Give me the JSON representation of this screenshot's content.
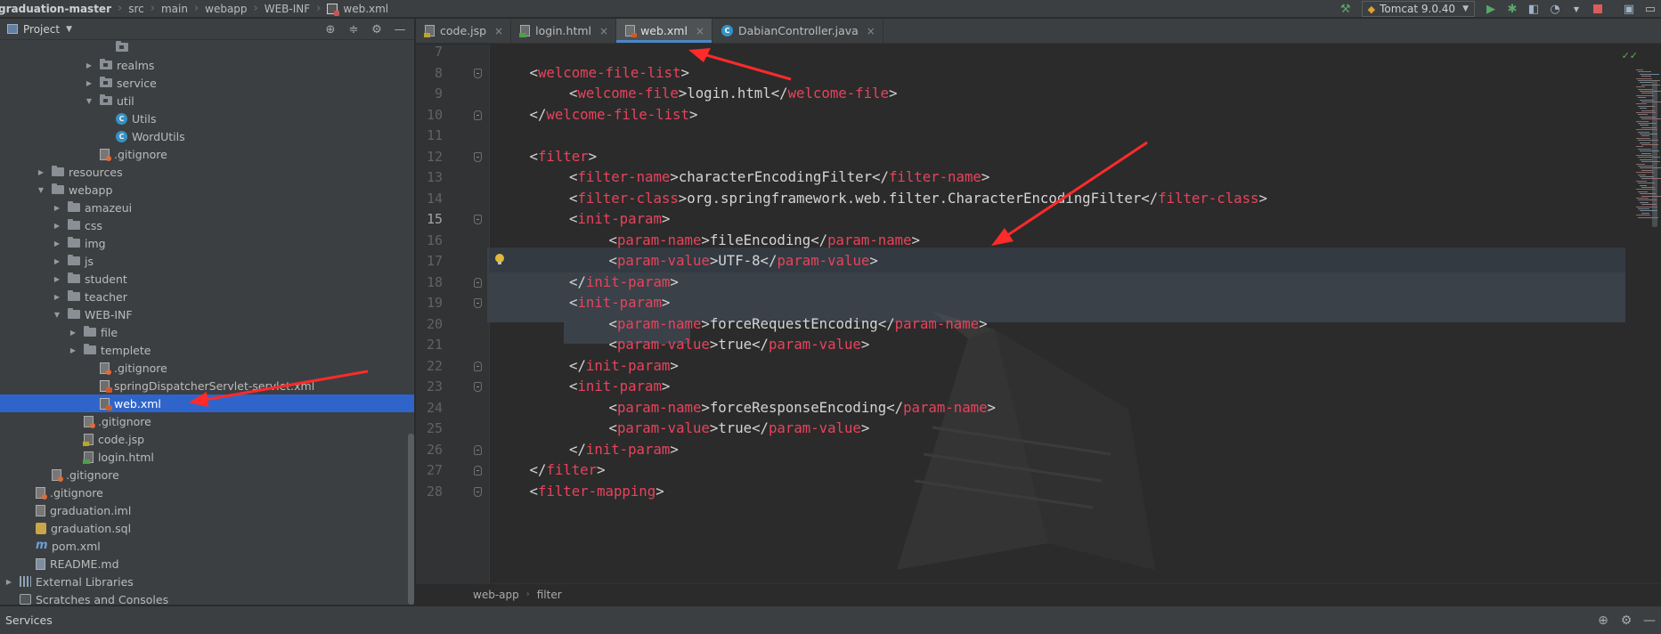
{
  "navbar": {
    "crumbs": [
      "graduation-master",
      "src",
      "main",
      "webapp",
      "WEB-INF",
      "web.xml"
    ],
    "run_config": "Tomcat 9.0.40",
    "icons": [
      "hammer-icon",
      "run-icon",
      "debug-icon",
      "coverage-icon",
      "profile-icon",
      "stop-icon",
      "project-structure-icon",
      "terminal-icon"
    ]
  },
  "project_panel": {
    "title": "Project",
    "tree": [
      {
        "label": "",
        "depth": 6,
        "type": "package",
        "cut": true
      },
      {
        "label": "realms",
        "depth": 5,
        "type": "package",
        "twisty": "collapsed"
      },
      {
        "label": "service",
        "depth": 5,
        "type": "package",
        "twisty": "collapsed"
      },
      {
        "label": "util",
        "depth": 5,
        "type": "package",
        "twisty": "expanded"
      },
      {
        "label": "Utils",
        "depth": 6,
        "type": "class"
      },
      {
        "label": "WordUtils",
        "depth": 6,
        "type": "class"
      },
      {
        "label": ".gitignore",
        "depth": 5,
        "type": "git"
      },
      {
        "label": "resources",
        "depth": 2,
        "type": "folder",
        "twisty": "collapsed"
      },
      {
        "label": "webapp",
        "depth": 2,
        "type": "folder",
        "twisty": "expanded"
      },
      {
        "label": "amazeui",
        "depth": 3,
        "type": "folder",
        "twisty": "collapsed"
      },
      {
        "label": "css",
        "depth": 3,
        "type": "folder",
        "twisty": "collapsed"
      },
      {
        "label": "img",
        "depth": 3,
        "type": "folder",
        "twisty": "collapsed"
      },
      {
        "label": "js",
        "depth": 3,
        "type": "folder",
        "twisty": "collapsed"
      },
      {
        "label": "student",
        "depth": 3,
        "type": "folder",
        "twisty": "collapsed"
      },
      {
        "label": "teacher",
        "depth": 3,
        "type": "folder",
        "twisty": "collapsed"
      },
      {
        "label": "WEB-INF",
        "depth": 3,
        "type": "folder",
        "twisty": "expanded"
      },
      {
        "label": "file",
        "depth": 4,
        "type": "folder",
        "twisty": "collapsed"
      },
      {
        "label": "templete",
        "depth": 4,
        "type": "folder",
        "twisty": "collapsed"
      },
      {
        "label": ".gitignore",
        "depth": 5,
        "type": "git"
      },
      {
        "label": "springDispatcherServlet-servlet.xml",
        "depth": 5,
        "type": "xml"
      },
      {
        "label": "web.xml",
        "depth": 5,
        "type": "xml",
        "selected": true
      },
      {
        "label": ".gitignore",
        "depth": 4,
        "type": "git"
      },
      {
        "label": "code.jsp",
        "depth": 4,
        "type": "jsp"
      },
      {
        "label": "login.html",
        "depth": 4,
        "type": "html"
      },
      {
        "label": ".gitignore",
        "depth": 2,
        "type": "git"
      },
      {
        "label": ".gitignore",
        "depth": 1,
        "type": "git"
      },
      {
        "label": "graduation.iml",
        "depth": 1,
        "type": "iml"
      },
      {
        "label": "graduation.sql",
        "depth": 1,
        "type": "sql"
      },
      {
        "label": "pom.xml",
        "depth": 1,
        "type": "maven"
      },
      {
        "label": "README.md",
        "depth": 1,
        "type": "md"
      },
      {
        "label": "External Libraries",
        "depth": 0,
        "type": "lib",
        "twisty": "collapsed"
      },
      {
        "label": "Scratches and Consoles",
        "depth": 0,
        "type": "scratch"
      }
    ]
  },
  "tabs": [
    {
      "label": "code.jsp",
      "type": "jsp"
    },
    {
      "label": "login.html",
      "type": "html"
    },
    {
      "label": "web.xml",
      "type": "xml",
      "active": true
    },
    {
      "label": "DabianController.java",
      "type": "java"
    }
  ],
  "editor": {
    "current_line": 15,
    "lines": [
      {
        "n": 7,
        "code": []
      },
      {
        "n": 8,
        "indent": 1,
        "fold": "start",
        "code": [
          [
            "bk",
            "<"
          ],
          [
            "tg",
            "welcome-file-list"
          ],
          [
            "bk",
            ">"
          ]
        ]
      },
      {
        "n": 9,
        "indent": 2,
        "code": [
          [
            "bk",
            "<"
          ],
          [
            "tg",
            "welcome-file"
          ],
          [
            "bk",
            ">"
          ],
          [
            "tx",
            "login.html"
          ],
          [
            "bk",
            "</"
          ],
          [
            "tg",
            "welcome-file"
          ],
          [
            "bk",
            ">"
          ]
        ]
      },
      {
        "n": 10,
        "indent": 1,
        "fold": "end",
        "code": [
          [
            "bk",
            "</"
          ],
          [
            "tg",
            "welcome-file-list"
          ],
          [
            "bk",
            ">"
          ]
        ]
      },
      {
        "n": 11,
        "code": []
      },
      {
        "n": 12,
        "indent": 1,
        "fold": "start",
        "code": [
          [
            "bk",
            "<"
          ],
          [
            "tg",
            "filter"
          ],
          [
            "bk",
            ">"
          ]
        ]
      },
      {
        "n": 13,
        "indent": 2,
        "code": [
          [
            "bk",
            "<"
          ],
          [
            "tg",
            "filter-name"
          ],
          [
            "bk",
            ">"
          ],
          [
            "tx",
            "characterEncodingFilter"
          ],
          [
            "bk",
            "</"
          ],
          [
            "tg",
            "filter-name"
          ],
          [
            "bk",
            ">"
          ]
        ]
      },
      {
        "n": 14,
        "indent": 2,
        "code": [
          [
            "bk",
            "<"
          ],
          [
            "tg",
            "filter-class"
          ],
          [
            "bk",
            ">"
          ],
          [
            "tx",
            "org.springframework.web.filter.CharacterEncodingFilter"
          ],
          [
            "bk",
            "</"
          ],
          [
            "tg",
            "filter-class"
          ],
          [
            "bk",
            ">"
          ]
        ]
      },
      {
        "n": 15,
        "indent": 2,
        "fold": "start",
        "code": [
          [
            "bk",
            "<"
          ],
          [
            "tg",
            "init-param"
          ],
          [
            "bk",
            ">"
          ]
        ]
      },
      {
        "n": 16,
        "indent": 3,
        "code": [
          [
            "bk",
            "<"
          ],
          [
            "tg",
            "param-name"
          ],
          [
            "bk",
            ">"
          ],
          [
            "tx",
            "fileEncoding"
          ],
          [
            "bk",
            "</"
          ],
          [
            "tg",
            "param-name"
          ],
          [
            "bk",
            ">"
          ]
        ]
      },
      {
        "n": 17,
        "indent": 3,
        "code": [
          [
            "bk",
            "<"
          ],
          [
            "tg",
            "param-value"
          ],
          [
            "bk",
            ">"
          ],
          [
            "tx",
            "UTF-8"
          ],
          [
            "bk",
            "</"
          ],
          [
            "tg",
            "param-value"
          ],
          [
            "bk",
            ">"
          ]
        ]
      },
      {
        "n": 18,
        "indent": 2,
        "fold": "end",
        "code": [
          [
            "bk",
            "</"
          ],
          [
            "tg",
            "init-param"
          ],
          [
            "bk",
            ">"
          ]
        ]
      },
      {
        "n": 19,
        "indent": 2,
        "fold": "start",
        "code": [
          [
            "bk",
            "<"
          ],
          [
            "tg",
            "init-param"
          ],
          [
            "bk",
            ">"
          ]
        ]
      },
      {
        "n": 20,
        "indent": 3,
        "code": [
          [
            "bk",
            "<"
          ],
          [
            "tg",
            "param-name"
          ],
          [
            "bk",
            ">"
          ],
          [
            "tx",
            "forceRequestEncoding"
          ],
          [
            "bk",
            "</"
          ],
          [
            "tg",
            "param-name"
          ],
          [
            "bk",
            ">"
          ]
        ]
      },
      {
        "n": 21,
        "indent": 3,
        "code": [
          [
            "bk",
            "<"
          ],
          [
            "tg",
            "param-value"
          ],
          [
            "bk",
            ">"
          ],
          [
            "tx",
            "true"
          ],
          [
            "bk",
            "</"
          ],
          [
            "tg",
            "param-value"
          ],
          [
            "bk",
            ">"
          ]
        ]
      },
      {
        "n": 22,
        "indent": 2,
        "fold": "end",
        "code": [
          [
            "bk",
            "</"
          ],
          [
            "tg",
            "init-param"
          ],
          [
            "bk",
            ">"
          ]
        ]
      },
      {
        "n": 23,
        "indent": 2,
        "fold": "start",
        "code": [
          [
            "bk",
            "<"
          ],
          [
            "tg",
            "init-param"
          ],
          [
            "bk",
            ">"
          ]
        ]
      },
      {
        "n": 24,
        "indent": 3,
        "code": [
          [
            "bk",
            "<"
          ],
          [
            "tg",
            "param-name"
          ],
          [
            "bk",
            ">"
          ],
          [
            "tx",
            "forceResponseEncoding"
          ],
          [
            "bk",
            "</"
          ],
          [
            "tg",
            "param-name"
          ],
          [
            "bk",
            ">"
          ]
        ]
      },
      {
        "n": 25,
        "indent": 3,
        "code": [
          [
            "bk",
            "<"
          ],
          [
            "tg",
            "param-value"
          ],
          [
            "bk",
            ">"
          ],
          [
            "tx",
            "true"
          ],
          [
            "bk",
            "</"
          ],
          [
            "tg",
            "param-value"
          ],
          [
            "bk",
            ">"
          ]
        ]
      },
      {
        "n": 26,
        "indent": 2,
        "fold": "end",
        "code": [
          [
            "bk",
            "</"
          ],
          [
            "tg",
            "init-param"
          ],
          [
            "bk",
            ">"
          ]
        ]
      },
      {
        "n": 27,
        "indent": 1,
        "fold": "end",
        "code": [
          [
            "bk",
            "</"
          ],
          [
            "tg",
            "filter"
          ],
          [
            "bk",
            ">"
          ]
        ]
      },
      {
        "n": 28,
        "indent": 1,
        "fold": "start",
        "code": [
          [
            "bk",
            "<"
          ],
          [
            "tg",
            "filter-mapping"
          ],
          [
            "bk",
            ">"
          ]
        ]
      }
    ]
  },
  "breadcrumb": [
    "web-app",
    "filter"
  ],
  "services": {
    "label": "Services"
  },
  "colors": {
    "tag": "#e8435c",
    "text": "#d4d4d4",
    "selection": "#2f65ca",
    "arrow": "#ff2a2a",
    "accent": "#4a88c7"
  }
}
